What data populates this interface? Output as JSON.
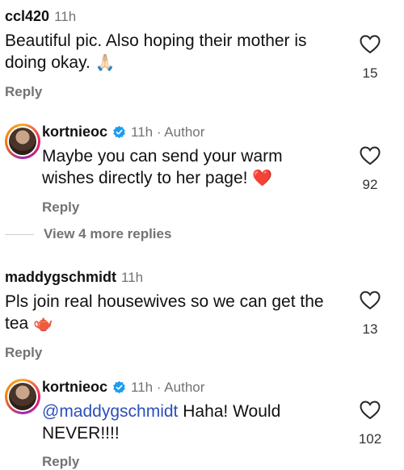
{
  "comments": [
    {
      "username": "ccl420",
      "time": "11h",
      "text": "Beautiful pic. Also hoping their mother is doing okay.",
      "emoji": "🙏🏻",
      "reply": "Reply",
      "likes": "15"
    },
    {
      "username": "kortnieoc",
      "time": "11h · Author",
      "text": "Maybe you can send your warm wishes directly to her page!",
      "emoji": "❤️",
      "reply": "Reply",
      "likes": "92"
    },
    {
      "username": "maddygschmidt",
      "time": "11h",
      "text": "Pls join real housewives so we can get the tea",
      "emoji": "🫖",
      "reply": "Reply",
      "likes": "13"
    },
    {
      "username": "kortnieoc",
      "time": "11h · Author",
      "mention": "@maddygschmidt",
      "text": " Haha! Would NEVER!!!!",
      "reply": "Reply",
      "likes": "102"
    }
  ],
  "view_more": "View 4 more replies",
  "colors": {
    "secondary_text": "#737373",
    "mention": "#2b4fbd",
    "verified": "#1d9bf0",
    "heart_emoji": "#e0245e"
  },
  "icons": [
    "heart-outline-icon",
    "verified-badge-icon",
    "avatar-story-ring"
  ]
}
